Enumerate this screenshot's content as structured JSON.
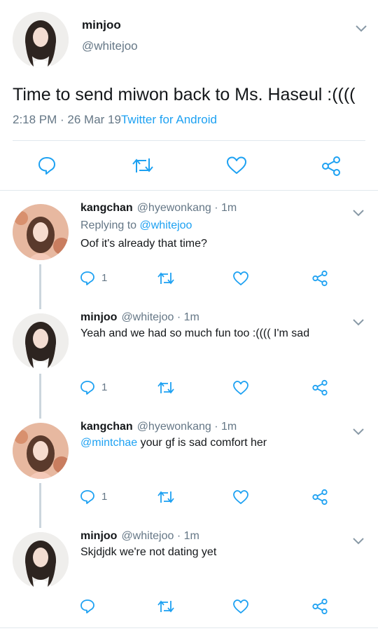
{
  "main_tweet": {
    "name": "minjoo",
    "handle": "@whitejoo",
    "text": "Time to send miwon back to Ms. Haseul :((((",
    "time": "2:18 PM · 26 Mar 19",
    "source": "Twitter for Android",
    "actions": [
      "reply-icon",
      "retweet-icon",
      "like-icon",
      "share-icon"
    ]
  },
  "replies": [
    {
      "name": "kangchan",
      "handle": "@hyewonkang · 1m",
      "replying_prefix": "Replying to ",
      "replying_to": "@whitejoo",
      "text": "Oof it's already that time?",
      "reply_count": "1"
    },
    {
      "name": "minjoo",
      "handle": "@whitejoo · 1m",
      "text": "Yeah and we had so much fun too :(((( I'm sad",
      "reply_count": "1"
    },
    {
      "name": "kangchan",
      "handle": "@hyewonkang · 1m",
      "mention": "@mintchae",
      "text": " your gf is sad comfort her",
      "reply_count": "1"
    },
    {
      "name": "minjoo",
      "handle": "@whitejoo · 1m",
      "text": "Skjdjdk we're not dating yet",
      "reply_count": ""
    }
  ],
  "colors": {
    "accent": "#1da1f2",
    "muted": "#657786",
    "divider": "#e1e8ed",
    "thread": "#ccd6dd"
  }
}
